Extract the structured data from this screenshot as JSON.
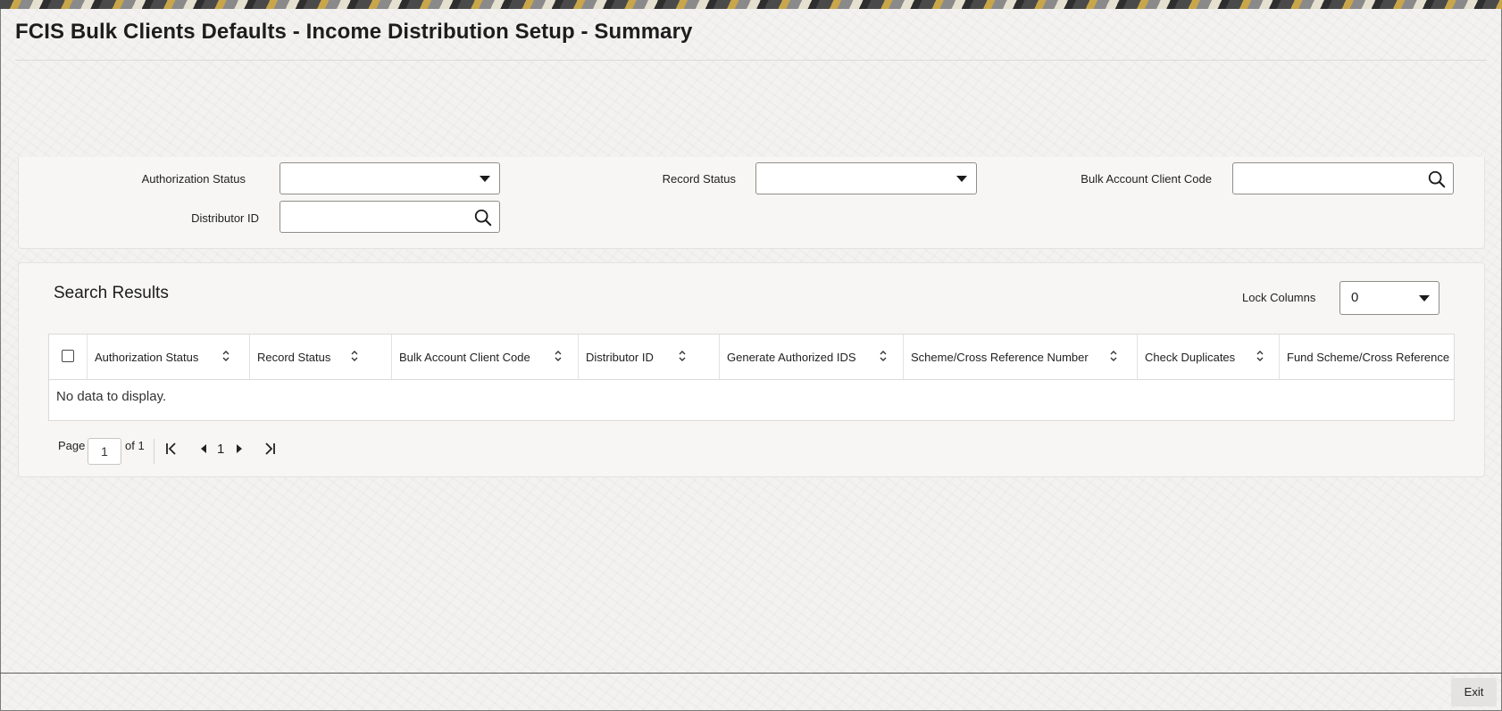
{
  "page": {
    "title": "FCIS Bulk Clients Defaults - Income Distribution Setup - Summary"
  },
  "search": {
    "authorization_status_label": "Authorization Status",
    "authorization_status_value": "",
    "record_status_label": "Record Status",
    "record_status_value": "",
    "bulk_account_client_code_label": "Bulk Account Client Code",
    "bulk_account_client_code_value": "",
    "distributor_id_label": "Distributor ID",
    "distributor_id_value": ""
  },
  "results": {
    "title": "Search Results",
    "lock_columns_label": "Lock Columns",
    "lock_columns_value": "0",
    "columns": [
      "Authorization Status",
      "Record Status",
      "Bulk Account Client Code",
      "Distributor ID",
      "Generate Authorized IDS",
      "Scheme/Cross Reference Number",
      "Check Duplicates",
      "Fund Scheme/Cross Reference"
    ],
    "empty_message": "No data to display."
  },
  "pagination": {
    "page_label": "Page",
    "current_page": "1",
    "of_label": "of 1",
    "page_number": "1"
  },
  "footer": {
    "exit_label": "Exit"
  },
  "icons": {
    "dropdown": "chevron-down-icon",
    "search": "search-icon",
    "sort": "sort-icon",
    "first": "first-page-icon",
    "prev": "previous-page-icon",
    "next": "next-page-icon",
    "last": "last-page-icon"
  }
}
